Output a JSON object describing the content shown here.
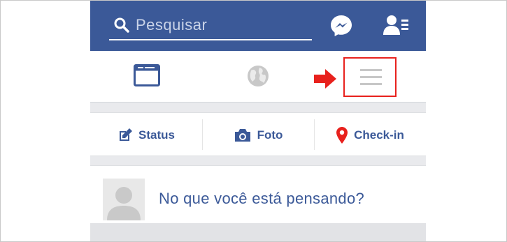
{
  "search": {
    "placeholder": "Pesquisar",
    "icon": "search-icon"
  },
  "topbar": {
    "color": "#3b5998",
    "icons": [
      "messenger-icon",
      "friend-requests-icon"
    ]
  },
  "nav": {
    "items": [
      {
        "name": "news-feed",
        "icon": "news-feed-icon"
      },
      {
        "name": "globe",
        "icon": "globe-icon"
      },
      {
        "name": "menu",
        "icon": "hamburger-menu-icon",
        "highlighted": true
      }
    ],
    "highlight_color": "#e8211d"
  },
  "composer": {
    "status_label": "Status",
    "photo_label": "Foto",
    "checkin_label": "Check-in"
  },
  "post": {
    "prompt": "No que você está pensando?"
  }
}
